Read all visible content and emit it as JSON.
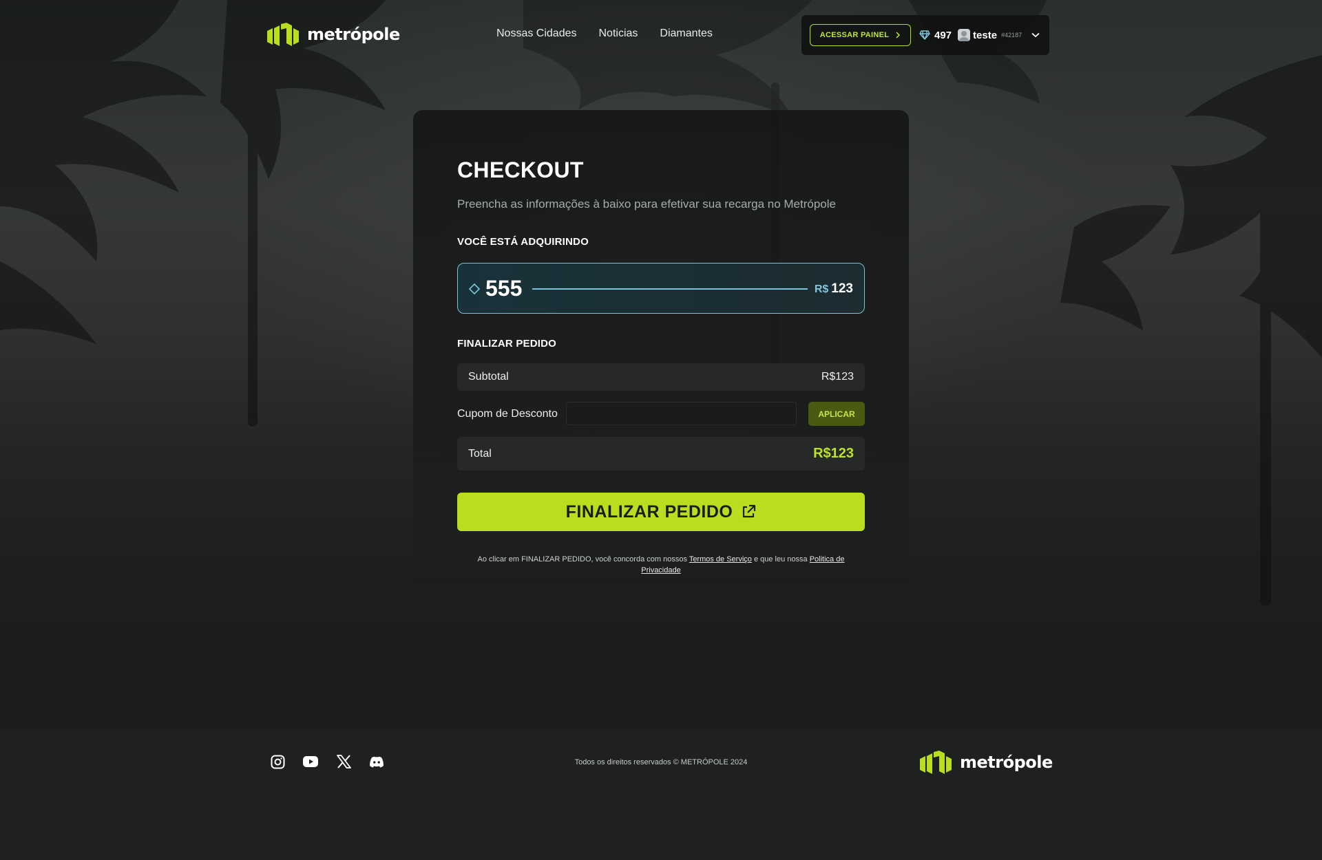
{
  "header": {
    "brand": "metrópole",
    "nav": [
      "Nossas Cidades",
      "Noticias",
      "Diamantes"
    ],
    "painel_button": "ACESSAR PAINEL",
    "diamonds": "497",
    "username": "teste",
    "user_id": "#42187"
  },
  "checkout": {
    "title": "CHECKOUT",
    "subtitle": "Preencha as informações à baixo para efetivar sua recarga no Metrópole",
    "acquiring_label": "VOCÊ ESTÁ ADQUIRINDO",
    "product": {
      "quantity": "555",
      "currency": "R$",
      "price": "123"
    },
    "finalize_label": "FINALIZAR PEDIDO",
    "subtotal_label": "Subtotal",
    "subtotal_value": "R$123",
    "coupon_label": "Cupom de Desconto",
    "coupon_value": "",
    "coupon_placeholder": "",
    "apply_button": "APLICAR",
    "total_label": "Total",
    "total_value": "R$123",
    "finalize_button": "FINALIZAR PEDIDO",
    "terms": {
      "prefix": "Ao clicar em FINALIZAR PEDIDO, você concorda com nossos ",
      "terms_link": "Termos de Serviço",
      "middle": " e que leu nossa ",
      "privacy_link": "Politica de Privacidade"
    }
  },
  "footer": {
    "socials": [
      "instagram-icon",
      "youtube-icon",
      "x-icon",
      "discord-icon"
    ],
    "copyright": "Todos os direitos reservados © METRÓPOLE 2024",
    "brand": "metrópole"
  },
  "colors": {
    "accent": "#bade1f",
    "product_border": "#7ec3d6",
    "background": "#1d1f1e"
  }
}
